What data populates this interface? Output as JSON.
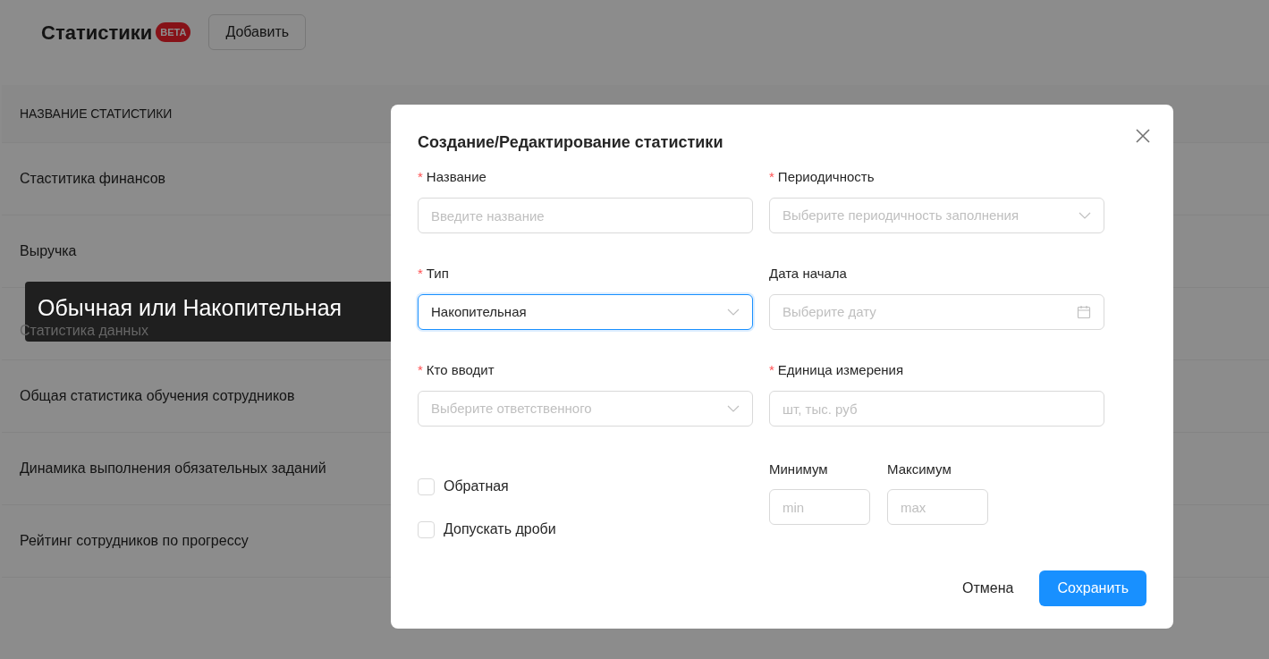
{
  "page": {
    "title": "Статистики",
    "badge": "BETA",
    "add_button": "Добавить",
    "table": {
      "columns": [
        "НАЗВАНИЕ СТАТИСТИКИ"
      ],
      "rows": [
        "Стаститика финансов",
        "Выручка",
        "Статистика данных",
        "Общая статистика обучения сотрудников",
        "Динамика выполнения обязательных заданий",
        "Рейтинг сотрудников по прогрессу"
      ]
    }
  },
  "modal": {
    "title": "Создание/Редактирование статистики",
    "required_mark": "*",
    "fields": [
      {
        "kind": "input",
        "label": "Название",
        "required": true,
        "placeholder": "Введите название"
      },
      {
        "kind": "select",
        "label": "Периодичность",
        "required": true,
        "placeholder": "Выберите периодичность заполнения",
        "focused": false
      },
      {
        "kind": "select",
        "label": "Тип",
        "required": true,
        "value": "Накопительная",
        "focused": true
      },
      {
        "kind": "date",
        "label": "Дата начала",
        "required": false,
        "placeholder": "Выберите дату"
      },
      {
        "kind": "select",
        "label": "Кто вводит",
        "required": true,
        "placeholder": "Выберите ответственного",
        "focused": false
      },
      {
        "kind": "input",
        "label": "Единица измерения",
        "required": true,
        "placeholder": "шт, тыс. руб"
      }
    ],
    "checkboxes": [
      {
        "label": "Обратная",
        "checked": false
      },
      {
        "label": "Допускать дроби",
        "checked": false
      }
    ],
    "range": [
      {
        "label": "Минимум",
        "placeholder": "min"
      },
      {
        "label": "Максимум",
        "placeholder": "max"
      }
    ],
    "cancel_button": "Отмена",
    "save_button": "Сохранить"
  },
  "tooltip": {
    "text": "Обычная или Накопительная"
  }
}
